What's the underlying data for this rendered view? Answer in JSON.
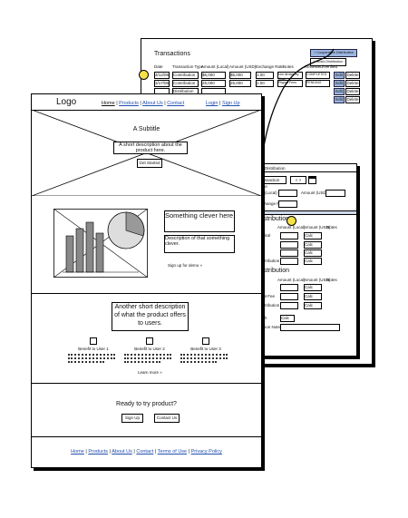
{
  "transactions": {
    "title": "Transactions",
    "actions": {
      "add": "+ Cooperative Distribution",
      "stock": "+ Stock Distribution"
    },
    "headers": [
      "Date",
      "Transaction Type",
      "Amount (Local)",
      "Amount (USD)",
      "Exchange Rate",
      "Notes",
      "Reviewed/Verified"
    ],
    "rows": [
      {
        "date": "3/12/06",
        "type": "Contribution",
        "local": "$5,000",
        "usd": "$5,000",
        "rate": "1.00",
        "notes": "Not dirdam by Cash",
        "status": "COMPLETED",
        "edit": "Edit",
        "del": "Delete"
      },
      {
        "date": "3/17/06",
        "type": "Contribution",
        "local": "25,000",
        "usd": "25,000",
        "rate": "1.00",
        "notes": "Pilgrim Fees",
        "status": "PENDING",
        "edit": "Edit",
        "del": "Delete"
      },
      {
        "date": "",
        "type": "Distribution",
        "local": "",
        "usd": "",
        "rate": "",
        "notes": "",
        "status": "",
        "edit": "Edit",
        "del": "Delete"
      },
      {
        "date": "",
        "type": "",
        "local": "",
        "usd": "",
        "rate": "",
        "notes": "",
        "status": "",
        "edit": "Edit",
        "del": "Delete"
      }
    ]
  },
  "distribution_form": {
    "title": "Distribution",
    "type_select": "Transaction Type",
    "date_select": "< >",
    "amount_local_label": "(Local)",
    "amount_usd_label": "Amount (USD)",
    "exchange_label": "Exchange Rate",
    "section1_title": "Distribution",
    "section1_headers": [
      "Amount (Local)",
      "Amount (USD)",
      "Notes"
    ],
    "section1_rows": [
      {
        "label": "Capital",
        "val": "Calc"
      },
      {
        "label": "",
        "val": "Calc"
      },
      {
        "label": "ts",
        "val": "Calc"
      },
      {
        "label": "Contribution",
        "val": "Calc"
      }
    ],
    "section2_title": "Distribution",
    "section2_headers": [
      "Amount (Local)",
      "Amount (USD)",
      "Notes"
    ],
    "section2_rows": [
      {
        "label": "Call",
        "val": "Calc"
      },
      {
        "label": "ment Fee",
        "val": "Calc"
      },
      {
        "label": "Contribution",
        "val": "Calc"
      }
    ],
    "cash_label": "Cash",
    "cash_val": "Calc",
    "notes_label": "saction Note"
  },
  "landing": {
    "logo": "Logo",
    "nav": [
      "Home",
      "Products",
      "About Us",
      "Contact"
    ],
    "auth": [
      "Login",
      "Sign Up"
    ],
    "hero_subtitle": "A Subtitle",
    "hero_description": "A short description about the product here.",
    "hero_button": "Get Started",
    "feature_title": "Something clever here",
    "feature_desc": "Description of that something clever.",
    "feature_cta": "Sign up for demo »",
    "offer_text": "Another short description of what the product offers to users.",
    "benefits": [
      "Benefit to User 1",
      "Benefit to User 2",
      "Benefit to User 3"
    ],
    "learn_more": "Learn more »",
    "cta_title": "Ready to try product?",
    "cta_buttons": [
      "Sign Up",
      "Contact Us"
    ],
    "footer_links": [
      "Home",
      "Products",
      "About Us",
      "Contact",
      "Terms of Use",
      "Privacy Policy"
    ]
  }
}
